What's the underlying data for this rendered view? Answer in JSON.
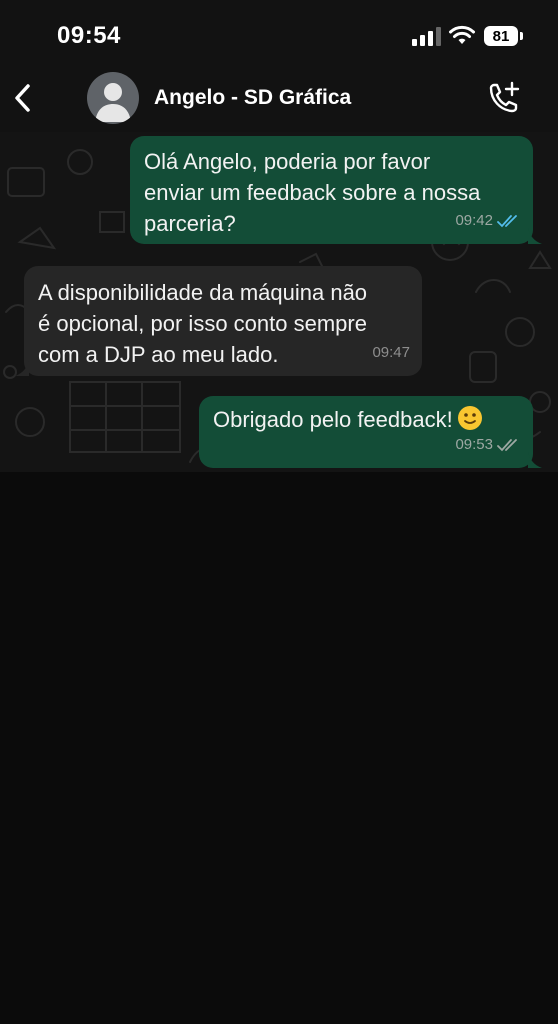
{
  "status_bar": {
    "time": "09:54",
    "battery": "81",
    "icons": [
      "signal-icon",
      "wifi-icon",
      "battery-icon"
    ]
  },
  "header": {
    "contact_name": "Angelo - SD Gráfica",
    "icons": [
      "chevron-left-icon",
      "avatar-placeholder-icon",
      "add-call-icon"
    ]
  },
  "colors": {
    "outgoing_bubble": "#134d37",
    "incoming_bubble": "#262626",
    "read_ticks": "#53bdeb",
    "delivered_ticks": "#9da8a3"
  },
  "messages": [
    {
      "direction": "outgoing",
      "text": "Olá Angelo, poderia por favor\nenviar um feedback sobre a nossa\nparceria?",
      "time": "09:42",
      "status": "read"
    },
    {
      "direction": "incoming",
      "text": "A disponibilidade da máquina não\né opcional, por isso conto sempre\ncom a DJP ao meu lado.",
      "time": "09:47"
    },
    {
      "direction": "outgoing",
      "text": "Obrigado pelo feedback!",
      "emoji": "slightly-smiling-face",
      "time": "09:53",
      "status": "delivered"
    }
  ]
}
